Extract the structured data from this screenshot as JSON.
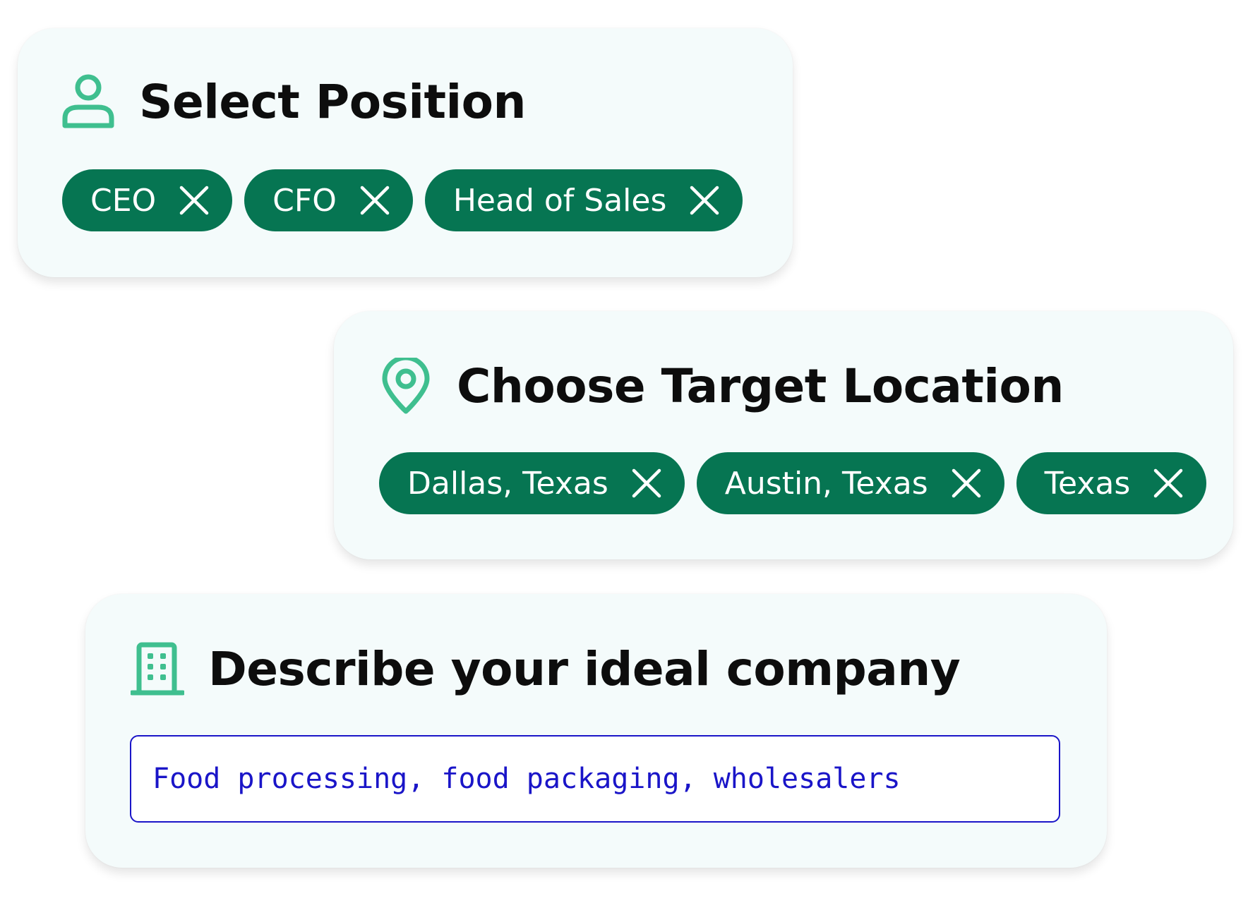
{
  "colors": {
    "accent": "#067552",
    "icon": "#3fbf8f",
    "card_background": "#f4fbfb",
    "input_text": "#1a15c8"
  },
  "position_card": {
    "title": "Select Position",
    "icon": "user-icon",
    "chips": [
      {
        "label": "CEO"
      },
      {
        "label": "CFO"
      },
      {
        "label": "Head of Sales"
      }
    ]
  },
  "location_card": {
    "title": "Choose Target Location",
    "icon": "map-pin-icon",
    "chips": [
      {
        "label": "Dallas, Texas"
      },
      {
        "label": "Austin, Texas"
      },
      {
        "label": "Texas"
      }
    ]
  },
  "company_card": {
    "title": "Describe your ideal company",
    "icon": "building-icon",
    "input_value": "Food processing, food packaging, wholesalers"
  }
}
